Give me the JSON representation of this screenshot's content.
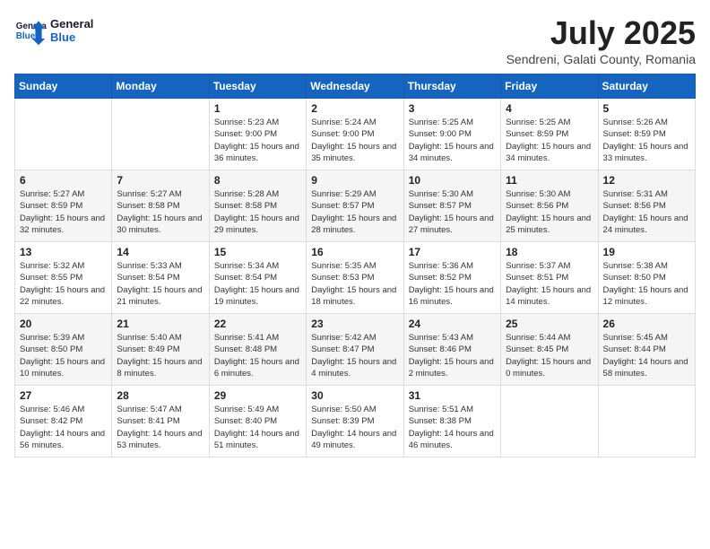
{
  "header": {
    "logo_general": "General",
    "logo_blue": "Blue",
    "month_title": "July 2025",
    "location": "Sendreni, Galati County, Romania"
  },
  "weekdays": [
    "Sunday",
    "Monday",
    "Tuesday",
    "Wednesday",
    "Thursday",
    "Friday",
    "Saturday"
  ],
  "weeks": [
    [
      {
        "day": "",
        "info": ""
      },
      {
        "day": "",
        "info": ""
      },
      {
        "day": "1",
        "info": "Sunrise: 5:23 AM\nSunset: 9:00 PM\nDaylight: 15 hours and 36 minutes."
      },
      {
        "day": "2",
        "info": "Sunrise: 5:24 AM\nSunset: 9:00 PM\nDaylight: 15 hours and 35 minutes."
      },
      {
        "day": "3",
        "info": "Sunrise: 5:25 AM\nSunset: 9:00 PM\nDaylight: 15 hours and 34 minutes."
      },
      {
        "day": "4",
        "info": "Sunrise: 5:25 AM\nSunset: 8:59 PM\nDaylight: 15 hours and 34 minutes."
      },
      {
        "day": "5",
        "info": "Sunrise: 5:26 AM\nSunset: 8:59 PM\nDaylight: 15 hours and 33 minutes."
      }
    ],
    [
      {
        "day": "6",
        "info": "Sunrise: 5:27 AM\nSunset: 8:59 PM\nDaylight: 15 hours and 32 minutes."
      },
      {
        "day": "7",
        "info": "Sunrise: 5:27 AM\nSunset: 8:58 PM\nDaylight: 15 hours and 30 minutes."
      },
      {
        "day": "8",
        "info": "Sunrise: 5:28 AM\nSunset: 8:58 PM\nDaylight: 15 hours and 29 minutes."
      },
      {
        "day": "9",
        "info": "Sunrise: 5:29 AM\nSunset: 8:57 PM\nDaylight: 15 hours and 28 minutes."
      },
      {
        "day": "10",
        "info": "Sunrise: 5:30 AM\nSunset: 8:57 PM\nDaylight: 15 hours and 27 minutes."
      },
      {
        "day": "11",
        "info": "Sunrise: 5:30 AM\nSunset: 8:56 PM\nDaylight: 15 hours and 25 minutes."
      },
      {
        "day": "12",
        "info": "Sunrise: 5:31 AM\nSunset: 8:56 PM\nDaylight: 15 hours and 24 minutes."
      }
    ],
    [
      {
        "day": "13",
        "info": "Sunrise: 5:32 AM\nSunset: 8:55 PM\nDaylight: 15 hours and 22 minutes."
      },
      {
        "day": "14",
        "info": "Sunrise: 5:33 AM\nSunset: 8:54 PM\nDaylight: 15 hours and 21 minutes."
      },
      {
        "day": "15",
        "info": "Sunrise: 5:34 AM\nSunset: 8:54 PM\nDaylight: 15 hours and 19 minutes."
      },
      {
        "day": "16",
        "info": "Sunrise: 5:35 AM\nSunset: 8:53 PM\nDaylight: 15 hours and 18 minutes."
      },
      {
        "day": "17",
        "info": "Sunrise: 5:36 AM\nSunset: 8:52 PM\nDaylight: 15 hours and 16 minutes."
      },
      {
        "day": "18",
        "info": "Sunrise: 5:37 AM\nSunset: 8:51 PM\nDaylight: 15 hours and 14 minutes."
      },
      {
        "day": "19",
        "info": "Sunrise: 5:38 AM\nSunset: 8:50 PM\nDaylight: 15 hours and 12 minutes."
      }
    ],
    [
      {
        "day": "20",
        "info": "Sunrise: 5:39 AM\nSunset: 8:50 PM\nDaylight: 15 hours and 10 minutes."
      },
      {
        "day": "21",
        "info": "Sunrise: 5:40 AM\nSunset: 8:49 PM\nDaylight: 15 hours and 8 minutes."
      },
      {
        "day": "22",
        "info": "Sunrise: 5:41 AM\nSunset: 8:48 PM\nDaylight: 15 hours and 6 minutes."
      },
      {
        "day": "23",
        "info": "Sunrise: 5:42 AM\nSunset: 8:47 PM\nDaylight: 15 hours and 4 minutes."
      },
      {
        "day": "24",
        "info": "Sunrise: 5:43 AM\nSunset: 8:46 PM\nDaylight: 15 hours and 2 minutes."
      },
      {
        "day": "25",
        "info": "Sunrise: 5:44 AM\nSunset: 8:45 PM\nDaylight: 15 hours and 0 minutes."
      },
      {
        "day": "26",
        "info": "Sunrise: 5:45 AM\nSunset: 8:44 PM\nDaylight: 14 hours and 58 minutes."
      }
    ],
    [
      {
        "day": "27",
        "info": "Sunrise: 5:46 AM\nSunset: 8:42 PM\nDaylight: 14 hours and 56 minutes."
      },
      {
        "day": "28",
        "info": "Sunrise: 5:47 AM\nSunset: 8:41 PM\nDaylight: 14 hours and 53 minutes."
      },
      {
        "day": "29",
        "info": "Sunrise: 5:49 AM\nSunset: 8:40 PM\nDaylight: 14 hours and 51 minutes."
      },
      {
        "day": "30",
        "info": "Sunrise: 5:50 AM\nSunset: 8:39 PM\nDaylight: 14 hours and 49 minutes."
      },
      {
        "day": "31",
        "info": "Sunrise: 5:51 AM\nSunset: 8:38 PM\nDaylight: 14 hours and 46 minutes."
      },
      {
        "day": "",
        "info": ""
      },
      {
        "day": "",
        "info": ""
      }
    ]
  ]
}
